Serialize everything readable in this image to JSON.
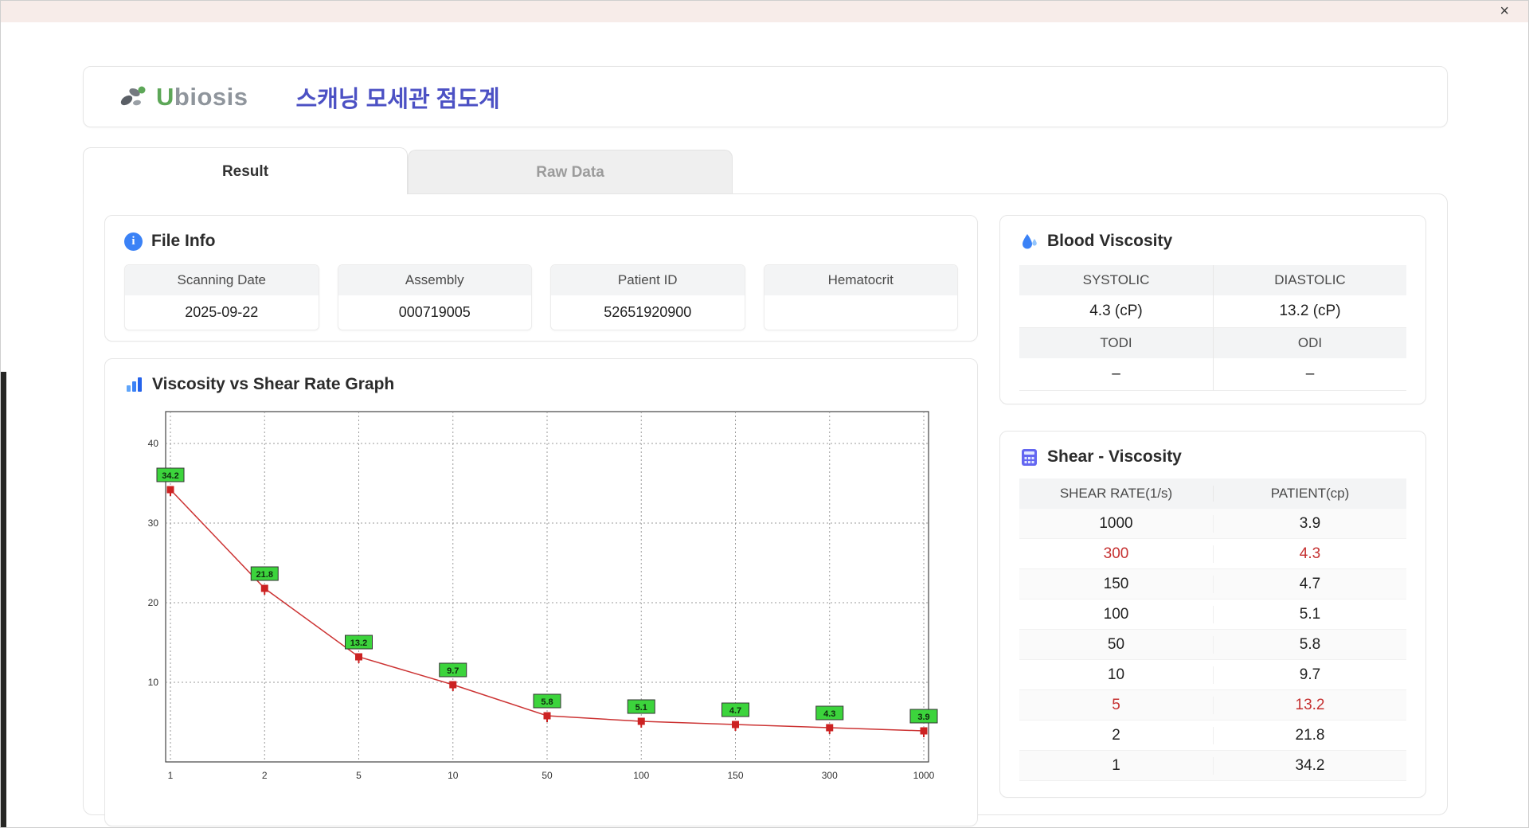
{
  "window": {
    "close_label": "×"
  },
  "header": {
    "logo_u": "U",
    "logo_rest": "biosis",
    "title": "스캐닝 모세관 점도계"
  },
  "tabs": [
    {
      "label": "Result",
      "active": true
    },
    {
      "label": "Raw Data",
      "active": false
    }
  ],
  "file_info": {
    "title": "File Info",
    "fields": [
      {
        "label": "Scanning Date",
        "value": "2025-09-22"
      },
      {
        "label": "Assembly",
        "value": "000719005"
      },
      {
        "label": "Patient ID",
        "value": "52651920900"
      },
      {
        "label": "Hematocrit",
        "value": ""
      }
    ]
  },
  "blood_viscosity": {
    "title": "Blood Viscosity",
    "rows": [
      {
        "headers": [
          "SYSTOLIC",
          "DIASTOLIC"
        ],
        "values": [
          "4.3 (cP)",
          "13.2 (cP)"
        ]
      },
      {
        "headers": [
          "TODI",
          "ODI"
        ],
        "values": [
          "–",
          "–"
        ]
      }
    ]
  },
  "shear_viscosity": {
    "title": "Shear - Viscosity",
    "columns": [
      "SHEAR RATE(1/s)",
      "PATIENT(cp)"
    ],
    "rows": [
      {
        "shear": "1000",
        "patient": "3.9",
        "highlight": false
      },
      {
        "shear": "300",
        "patient": "4.3",
        "highlight": true
      },
      {
        "shear": "150",
        "patient": "4.7",
        "highlight": false
      },
      {
        "shear": "100",
        "patient": "5.1",
        "highlight": false
      },
      {
        "shear": "50",
        "patient": "5.8",
        "highlight": false
      },
      {
        "shear": "10",
        "patient": "9.7",
        "highlight": false
      },
      {
        "shear": "5",
        "patient": "13.2",
        "highlight": true
      },
      {
        "shear": "2",
        "patient": "21.8",
        "highlight": false
      },
      {
        "shear": "1",
        "patient": "34.2",
        "highlight": false
      }
    ]
  },
  "chart_data": {
    "type": "line",
    "title": "Viscosity vs Shear Rate Graph",
    "x_labels": [
      "1",
      "2",
      "5",
      "10",
      "50",
      "100",
      "150",
      "300",
      "1000"
    ],
    "values": [
      34.2,
      21.8,
      13.2,
      9.7,
      5.8,
      5.1,
      4.7,
      4.3,
      3.9
    ],
    "y_ticks": [
      10,
      20,
      30,
      40
    ],
    "ylim": [
      0,
      44
    ],
    "xlabel": "",
    "ylabel": "",
    "grid": "dashed",
    "x_scale": "categorical-even",
    "legend": "none",
    "line_color": "#cc3333",
    "marker_color": "#cc2222",
    "label_bg": "#3cd43c",
    "label_border": "#333333"
  }
}
